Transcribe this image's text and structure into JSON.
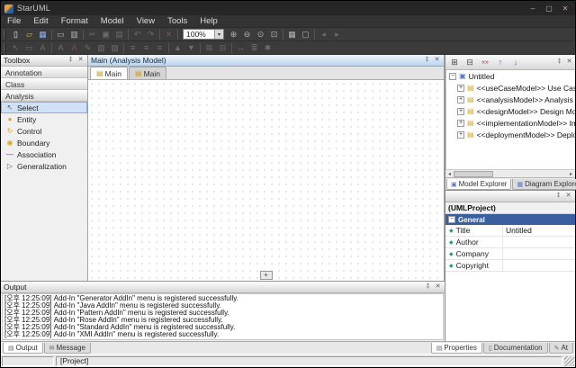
{
  "theme": {
    "titlebar_bg": "#262626",
    "menubar_bg": "#333333",
    "toolbar_bg": "#3b3b3b",
    "panel_bg": "#f0f0f0",
    "selection_bg": "#cfe0f7",
    "diagram_caption_bg": "#bcd4ec",
    "general_header_bg": "#3a5f9e",
    "folder_yellow": "#d8a820",
    "arrow_blue": "#1f7fd0"
  },
  "window": {
    "title": "StarUML",
    "minimize_label": "–",
    "maximize_label": "▢",
    "close_label": "✕"
  },
  "panel_chrome": {
    "pin": "‡",
    "close": "✕"
  },
  "menubar": {
    "items": [
      "File",
      "Edit",
      "Format",
      "Model",
      "View",
      "Tools",
      "Help"
    ]
  },
  "toolbar1": {
    "zoom_value": "100%",
    "zoom_arrow": "▾",
    "icons": [
      {
        "name": "new-icon",
        "glyph": "▯"
      },
      {
        "name": "open-icon",
        "glyph": "▱"
      },
      {
        "name": "save-icon",
        "glyph": "▦"
      },
      {
        "name": "print-icon",
        "glyph": "▭"
      },
      {
        "name": "print-preview-icon",
        "glyph": "▥"
      },
      {
        "name": "cut-icon",
        "glyph": "✂"
      },
      {
        "name": "copy-icon",
        "glyph": "▣"
      },
      {
        "name": "paste-icon",
        "glyph": "▤"
      },
      {
        "name": "undo-icon",
        "glyph": "↶"
      },
      {
        "name": "redo-icon",
        "glyph": "↷"
      },
      {
        "name": "delete-icon",
        "glyph": "✕"
      },
      {
        "name": "zoom-in-icon",
        "glyph": "⊕"
      },
      {
        "name": "zoom-out-icon",
        "glyph": "⊖"
      },
      {
        "name": "zoom-actual-icon",
        "glyph": "⊙"
      },
      {
        "name": "zoom-fit-icon",
        "glyph": "⊡"
      },
      {
        "name": "grid-icon",
        "glyph": "▦"
      },
      {
        "name": "overview-icon",
        "glyph": "▢"
      },
      {
        "name": "prev-diagram-icon",
        "glyph": "◂"
      },
      {
        "name": "next-diagram-icon",
        "glyph": "▸"
      }
    ]
  },
  "toolbar2": {
    "icons": [
      {
        "name": "select-pointer-icon",
        "glyph": "↖"
      },
      {
        "name": "note-icon",
        "glyph": "▭"
      },
      {
        "name": "text-icon",
        "glyph": "A"
      },
      {
        "name": "font-icon",
        "glyph": "A"
      },
      {
        "name": "font-color-icon",
        "glyph": "A"
      },
      {
        "name": "line-color-icon",
        "glyph": "✎"
      },
      {
        "name": "fill-color-icon",
        "glyph": "▨"
      },
      {
        "name": "shadow-icon",
        "glyph": "▧"
      },
      {
        "name": "align-left-icon",
        "glyph": "≡"
      },
      {
        "name": "align-center-icon",
        "glyph": "≡"
      },
      {
        "name": "align-right-icon",
        "glyph": "≡"
      },
      {
        "name": "bring-to-front-icon",
        "glyph": "▲"
      },
      {
        "name": "send-to-back-icon",
        "glyph": "▼"
      },
      {
        "name": "group-icon",
        "glyph": "⊞"
      },
      {
        "name": "ungroup-icon",
        "glyph": "⊟"
      },
      {
        "name": "fit-size-icon",
        "glyph": "↔"
      },
      {
        "name": "auto-layout-icon",
        "glyph": "≣"
      },
      {
        "name": "options-icon",
        "glyph": "✱"
      }
    ]
  },
  "toolbox": {
    "caption": "Toolbox",
    "sections": [
      "Annotation",
      "Class",
      "Analysis"
    ],
    "tools": [
      {
        "label": "Select",
        "glyph": "↖"
      },
      {
        "label": "Entity",
        "glyph": "●"
      },
      {
        "label": "Control",
        "glyph": "↻"
      },
      {
        "label": "Boundary",
        "glyph": "◉"
      },
      {
        "label": "Association",
        "glyph": "—"
      },
      {
        "label": "Generalization",
        "glyph": "▷"
      }
    ]
  },
  "diagram": {
    "caption": "Main (Analysis Model)",
    "tabs": [
      {
        "label": "Main",
        "icon": "▤"
      },
      {
        "label": "Main",
        "icon": "▤"
      }
    ],
    "nav_button": "+"
  },
  "model_explorer": {
    "toolbar": [
      {
        "name": "expand-all-icon",
        "glyph": "⊞"
      },
      {
        "name": "collapse-all-icon",
        "glyph": "⊟"
      },
      {
        "name": "show-stereotype-icon",
        "glyph": "«»"
      },
      {
        "name": "move-up-icon",
        "glyph": "↑"
      },
      {
        "name": "move-down-icon",
        "glyph": "↓"
      }
    ],
    "root": {
      "expand": "−",
      "icon": "▣",
      "label": "Untitled"
    },
    "items": [
      {
        "expand": "+",
        "icon": "▤",
        "label": "<<useCaseModel>> Use Case Model"
      },
      {
        "expand": "+",
        "icon": "▤",
        "label": "<<analysisModel>> Analysis Model"
      },
      {
        "expand": "+",
        "icon": "▤",
        "label": "<<designModel>> Design Model"
      },
      {
        "expand": "+",
        "icon": "▤",
        "label": "<<implementationModel>> Implementation Model"
      },
      {
        "expand": "+",
        "icon": "▤",
        "label": "<<deploymentModel>> Deployment Model"
      }
    ],
    "hscroll": {
      "left": "◂",
      "right": "▸"
    },
    "tabs": [
      {
        "label": "Model Explorer",
        "icon": "▣"
      },
      {
        "label": "Diagram Explorer",
        "icon": "▦"
      }
    ]
  },
  "properties": {
    "object_label": "(UMLProject)",
    "group": {
      "expand": "−",
      "label": "General"
    },
    "rows": [
      {
        "bullet": "◆",
        "name": "Title",
        "value": "Untitled"
      },
      {
        "bullet": "◆",
        "name": "Author",
        "value": ""
      },
      {
        "bullet": "◆",
        "name": "Company",
        "value": ""
      },
      {
        "bullet": "◆",
        "name": "Copyright",
        "value": ""
      }
    ]
  },
  "output": {
    "caption": "Output",
    "lines": [
      "[오후 12:25:09] Add-In \"Generator AddIn\" menu is registered successfully.",
      "[오후 12:25:09] Add-In \"Java AddIn\" menu is registered successfully.",
      "[오후 12:25:09] Add-In \"Pattern AddIn\" menu is registered successfully.",
      "[오후 12:25:09] Add-In \"Rose AddIn\" menu is registered successfully.",
      "[오후 12:25:09] Add-In \"Standard AddIn\" menu is registered successfully.",
      "[오후 12:25:09] Add-In \"XMI AddIn\" menu is registered successfully."
    ]
  },
  "bottom_tabs": {
    "left": [
      {
        "label": "Output",
        "icon": "▤"
      },
      {
        "label": "Message",
        "icon": "✉"
      }
    ],
    "right": [
      {
        "label": "Properties",
        "icon": "▤"
      },
      {
        "label": "Documentation",
        "icon": "▯"
      },
      {
        "label": "At",
        "icon": "✎"
      }
    ]
  },
  "statusbar": {
    "project": "[Project]"
  }
}
